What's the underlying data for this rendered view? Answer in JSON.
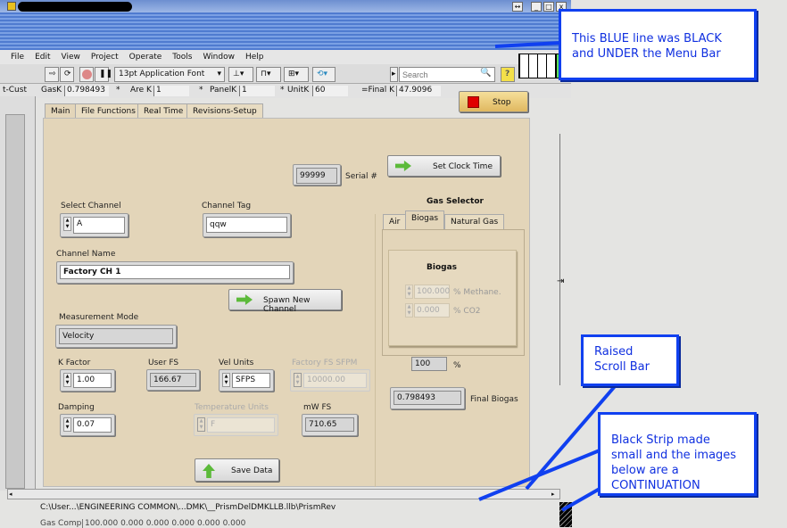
{
  "window": {
    "minimize": "_",
    "maximize": "□",
    "close": "x",
    "resize": "↔"
  },
  "menu": [
    "File",
    "Edit",
    "View",
    "Project",
    "Operate",
    "Tools",
    "Window",
    "Help"
  ],
  "toolbar": {
    "font": "13pt Application Font",
    "search_placeholder": "Search",
    "help": "?"
  },
  "krow": {
    "left_label": "t-Cust",
    "gask_label": "GasK",
    "gask": "0.798493",
    "op1": "*",
    "arek_label": "Are K",
    "arek": "1",
    "op2": "*",
    "panelk_label": "PanelK",
    "panelk": "1",
    "op3": "*",
    "unitk_label": "UnitK",
    "unitk": "60",
    "finalk_label": "=Final K",
    "finalk": "47.9096"
  },
  "stop_label": "Stop",
  "tabs": [
    "Main",
    "File Functions",
    "Real Time",
    "Revisions-Setup"
  ],
  "main": {
    "serial_value": "99999",
    "serial_label": "Serial #",
    "set_clock": "Set Clock Time",
    "select_channel_label": "Select Channel",
    "select_channel": "A",
    "channel_tag_label": "Channel Tag",
    "channel_tag": "qqw",
    "channel_name_label": "Channel Name",
    "channel_name": "Factory CH 1",
    "spawn": "Spawn New Channel",
    "measurement_mode_label": "Measurement Mode",
    "measurement_mode": "Velocity",
    "kfactor_label": "K Factor",
    "kfactor": "1.00",
    "userfs_label": "User FS",
    "userfs": "166.67",
    "velunits_label": "Vel Units",
    "velunits": "SFPS",
    "factoryfs_label": "Factory FS SFPM",
    "factoryfs": "10000.00",
    "damping_label": "Damping",
    "damping": "0.07",
    "tempunits_label": "Temperature Units",
    "tempunits": "F",
    "mwfs_label": "mW FS",
    "mwfs": "710.65",
    "save": "Save Data"
  },
  "gas": {
    "title": "Gas Selector",
    "tabs": [
      "Air",
      "Biogas",
      "Natural Gas"
    ],
    "box_title": "Biogas",
    "methane": "100.000",
    "methane_label": "% Methane.",
    "co2": "0.000",
    "co2_label": "% CO2",
    "pct": "100",
    "pct_label": "%",
    "final": "0.798493",
    "final_label": "Final Biogas"
  },
  "status": {
    "path": "C:\\User...\\ENGINEERING COMMON\\...DMK\\__PrismDelDMKLLB.llb\\PrismRev",
    "gas_comp_label": "Gas Comp",
    "gas_comp": "100.000 0.000 0.000 0.000 0.000 0.000"
  },
  "callouts": {
    "blue_line": "This BLUE line was BLACK and UNDER the Menu Bar",
    "scroll": "Raised Scroll Bar",
    "strip": "Black Strip made small and the images below are a CONTINUATION"
  },
  "colors": {
    "callout": "#1040f0",
    "panel": "#e3d5b9",
    "stop": "#e00000"
  }
}
